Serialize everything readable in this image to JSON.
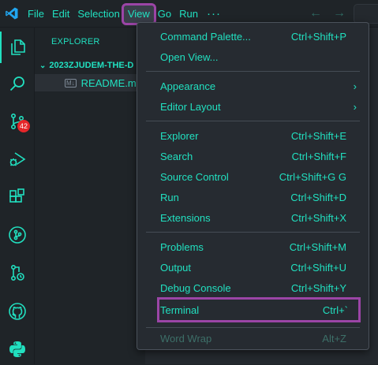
{
  "menubar": {
    "items": [
      "File",
      "Edit",
      "Selection",
      "View",
      "Go",
      "Run"
    ],
    "more": "···",
    "active": "View"
  },
  "nav": {
    "back": "←",
    "forward": "→"
  },
  "activity": {
    "badge": "42"
  },
  "sidebar": {
    "title": "EXPLORER",
    "folder": "2023ZJUDEM-THE-D",
    "md_icon": "M↓",
    "file": "README.md"
  },
  "view_menu": {
    "items": [
      {
        "label": "Command Palette...",
        "shortcut": "Ctrl+Shift+P"
      },
      {
        "label": "Open View...",
        "shortcut": ""
      },
      {
        "label": "Appearance",
        "submenu": true
      },
      {
        "label": "Editor Layout",
        "submenu": true
      },
      {
        "label": "Explorer",
        "shortcut": "Ctrl+Shift+E"
      },
      {
        "label": "Search",
        "shortcut": "Ctrl+Shift+F"
      },
      {
        "label": "Source Control",
        "shortcut": "Ctrl+Shift+G G"
      },
      {
        "label": "Run",
        "shortcut": "Ctrl+Shift+D"
      },
      {
        "label": "Extensions",
        "shortcut": "Ctrl+Shift+X"
      },
      {
        "label": "Problems",
        "shortcut": "Ctrl+Shift+M"
      },
      {
        "label": "Output",
        "shortcut": "Ctrl+Shift+U"
      },
      {
        "label": "Debug Console",
        "shortcut": "Ctrl+Shift+Y"
      },
      {
        "label": "Terminal",
        "shortcut": "Ctrl+`"
      },
      {
        "label": "Word Wrap",
        "shortcut": "Alt+Z",
        "disabled": true
      }
    ],
    "submenu_arrow": "›"
  },
  "colors": {
    "accent": "#21e0c0",
    "highlight_outline": "#9b45a6",
    "badge": "#e5262a",
    "background": "#1f2428",
    "menu_background": "#262b31"
  }
}
